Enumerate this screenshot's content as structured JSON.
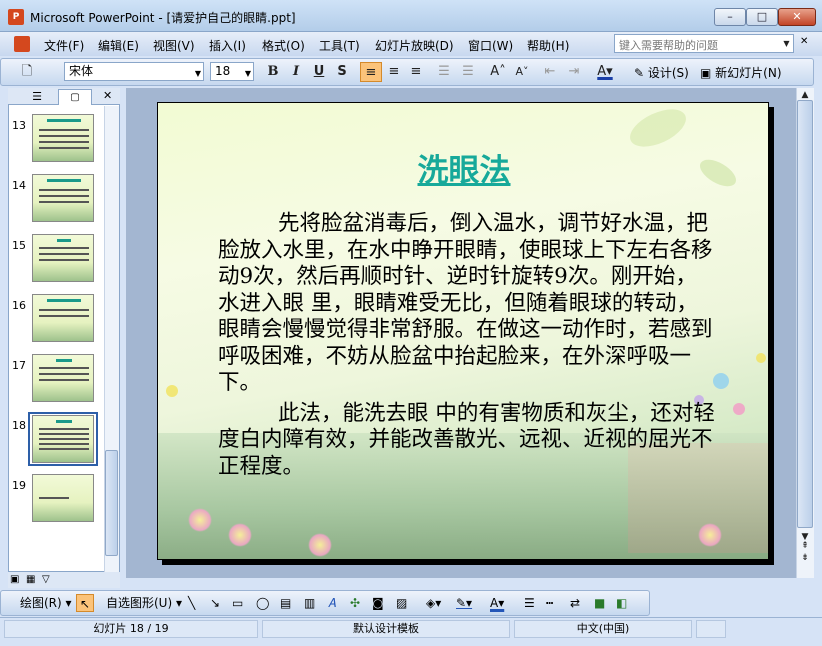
{
  "window": {
    "app_icon_text": "P",
    "title": "Microsoft PowerPoint - [请爱护自己的眼睛.ppt]",
    "min": "–",
    "max": "□",
    "close": "✕"
  },
  "menu": {
    "items": [
      "文件(F)",
      "编辑(E)",
      "视图(V)",
      "插入(I)",
      "格式(O)",
      "工具(T)",
      "幻灯片放映(D)",
      "窗口(W)",
      "帮助(H)"
    ],
    "help_placeholder": "键入需要帮助的问题",
    "mdi_min": "–"
  },
  "toolbar": {
    "font_name": "宋体",
    "font_size": "18",
    "bold": "B",
    "italic": "I",
    "underline": "U",
    "shadow": "S",
    "design_label": "设计(S)",
    "new_slide_label": "新幻灯片(N)"
  },
  "thumbnails": {
    "numbers": [
      "13",
      "14",
      "15",
      "16",
      "17",
      "18",
      "19"
    ],
    "selected": "18"
  },
  "slide": {
    "title": "洗眼法",
    "paragraphs": [
      "先将脸盆消毒后，倒入温水，调节好水温，把脸放入水里，在水中睁开眼睛，使眼球上下左右各移动9次，然后再顺时针、逆时针旋转9次。刚开始，水进入眼 里，眼睛难受无比，但随着眼球的转动，眼睛会慢慢觉得非常舒服。在做这一动作时，若感到呼吸困难，不妨从脸盆中抬起脸来，在外深呼吸一下。",
      "此法，能洗去眼 中的有害物质和灰尘，还对轻度白内障有效，并能改善散光、远视、近视的屈光不正程度。"
    ]
  },
  "drawing_toolbar": {
    "draw_label": "绘图(R)",
    "autoshape_label": "自选图形(U)"
  },
  "status": {
    "slide_pos": "幻灯片 18 / 19",
    "design": "默认设计模板",
    "language": "中文(中国)"
  },
  "colors": {
    "title_teal": "#17a99a",
    "selection": "#2d5fa8",
    "toolbar_active": "#fbc37a"
  }
}
